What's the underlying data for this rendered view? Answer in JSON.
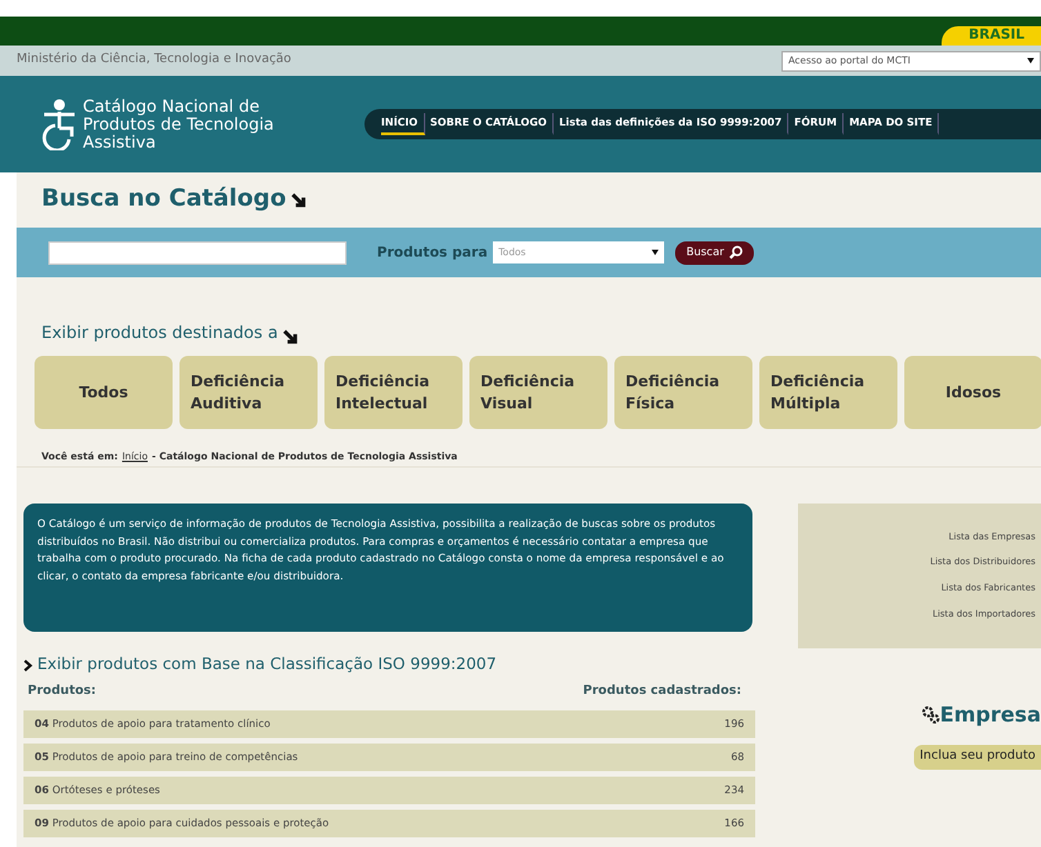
{
  "top_bar": {
    "brand": "BRASIL"
  },
  "ministry_bar": {
    "title": "Ministério da Ciência, Tecnologia e Inovação",
    "portal_select": {
      "value": "Acesso ao portal do MCTI"
    }
  },
  "header": {
    "logo_lines": [
      "Catálogo Nacional de",
      "Produtos de Tecnologia",
      "Assistiva"
    ],
    "nav": [
      {
        "label": "INÍCIO",
        "selected": true
      },
      {
        "label": "SOBRE O CATÁLOGO",
        "selected": false
      },
      {
        "label": "Lista das definições da ISO 9999:2007",
        "selected": false
      },
      {
        "label": "FÓRUM",
        "selected": false
      },
      {
        "label": "MAPA DO SITE",
        "selected": false
      }
    ]
  },
  "search": {
    "title": "Busca no Catálogo",
    "products_for_label": "Produtos para",
    "products_for_value": "Todos",
    "button": "Buscar"
  },
  "audience": {
    "title": "Exibir produtos destinados a",
    "tiles": [
      {
        "lines": [
          "Todos"
        ]
      },
      {
        "lines": [
          "Deficiência",
          "Auditiva"
        ]
      },
      {
        "lines": [
          "Deficiência",
          "Intelectual"
        ]
      },
      {
        "lines": [
          "Deficiência",
          "Visual"
        ]
      },
      {
        "lines": [
          "Deficiência",
          "Física"
        ]
      },
      {
        "lines": [
          "Deficiência",
          "Múltipla"
        ]
      },
      {
        "lines": [
          "Idosos"
        ]
      }
    ]
  },
  "breadcrumb": {
    "prefix": "Você está em:",
    "link": "Início",
    "rest": "- Catálogo Nacional de Produtos de Tecnologia Assistiva"
  },
  "info_text": "O Catálogo é um serviço de informação de produtos de Tecnologia Assistiva, possibilita a realização de buscas sobre os produtos distribuídos no Brasil. Não distribui ou comercializa produtos. Para compras e orçamentos é necessário contatar a empresa que trabalha com o produto procurado. Na ficha de cada produto cadastrado no Catálogo consta o nome da empresa responsável e ao clicar, o contato da empresa fabricante e/ou distribuidora.",
  "side_links": [
    "Lista das Empresas",
    "Lista dos Distribuidores",
    "Lista dos Fabricantes",
    "Lista dos Importadores"
  ],
  "iso": {
    "title": "Exibir produtos com Base na Classificação ISO 9999:2007",
    "col_products": "Produtos:",
    "col_count": "Produtos cadastrados:",
    "rows": [
      {
        "code": "04",
        "name": "Produtos de apoio para tratamento clínico",
        "count": "196"
      },
      {
        "code": "05",
        "name": "Produtos de apoio para treino de competências",
        "count": "68"
      },
      {
        "code": "06",
        "name": "Ortóteses e próteses",
        "count": "234"
      },
      {
        "code": "09",
        "name": "Produtos de apoio para cuidados pessoais e proteção",
        "count": "166"
      }
    ]
  },
  "company": {
    "title": "Empresa",
    "button": "Inclua seu produto"
  }
}
